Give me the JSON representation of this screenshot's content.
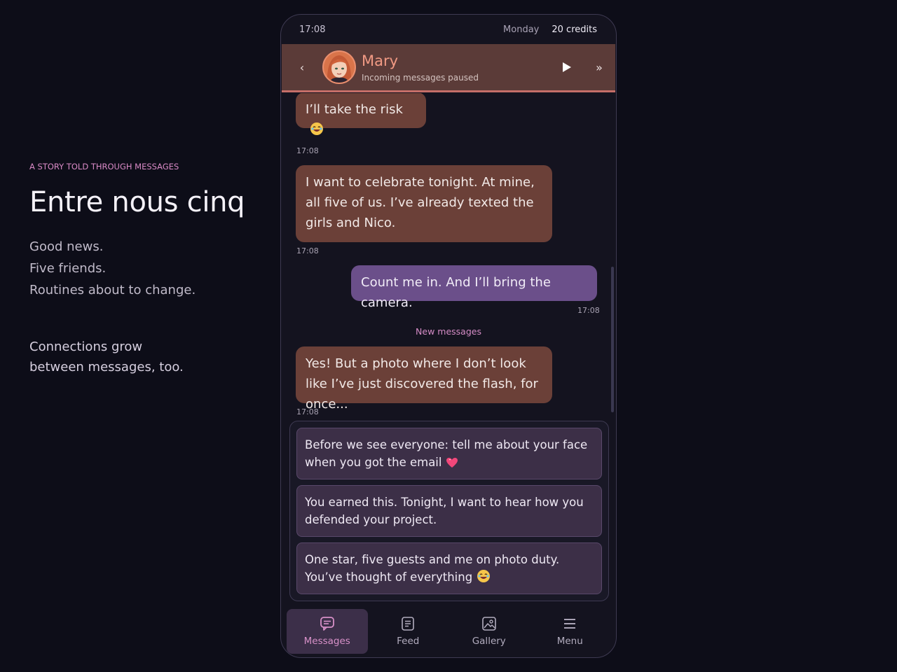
{
  "intro": {
    "eyebrow": "A STORY TOLD THROUGH MESSAGES",
    "title": "Entre nous cinq",
    "tagline": [
      "Good news.",
      "Five friends.",
      "Routines about to change."
    ],
    "closing": [
      "Connections grow",
      "between messages, too."
    ]
  },
  "status": {
    "time": "17:08",
    "day": "Monday",
    "credits": "20 credits"
  },
  "chat_header": {
    "back_label": "‹",
    "name": "Mary",
    "subtitle": "Incoming messages paused",
    "skip_label": "»"
  },
  "messages": [
    {
      "from": "Mary",
      "text": "I’ll take the risk",
      "emoji": "laughing-face-icon",
      "time": "17:08"
    },
    {
      "from": "Mary",
      "text": "I want to celebrate tonight. At mine, all five of us. I’ve already texted the girls and Nico.",
      "time": "17:08"
    },
    {
      "from": "me",
      "text": "Count me in. And I’ll bring the camera.",
      "time": "17:08"
    },
    {
      "from": "Mary",
      "text": "Yes! But a photo where I don’t look like I’ve just discovered the flash, for once...",
      "time": "17:08"
    }
  ],
  "new_messages_label": "New messages",
  "choices": [
    {
      "text": "Before we see everyone: tell me about your face when you got the email",
      "emoji": "heart-icon"
    },
    {
      "text": "You earned this. Tonight, I want to hear how you defended your project.",
      "emoji": ""
    },
    {
      "text": "One star, five guests and me on photo duty. You’ve thought of everything",
      "emoji": "laughing-face-icon"
    }
  ],
  "tabs": [
    {
      "label": "Messages",
      "icon": "chat-icon",
      "active": true
    },
    {
      "label": "Feed",
      "icon": "feed-icon",
      "active": false
    },
    {
      "label": "Gallery",
      "icon": "gallery-icon",
      "active": false
    },
    {
      "label": "Menu",
      "icon": "menu-icon",
      "active": false
    }
  ],
  "colors": {
    "accent": "#d790c8",
    "incoming_bubble": "#6b4038",
    "outgoing_bubble": "#6b4f8a",
    "header_bg": "#5b3b38",
    "header_name": "#f19a84"
  }
}
